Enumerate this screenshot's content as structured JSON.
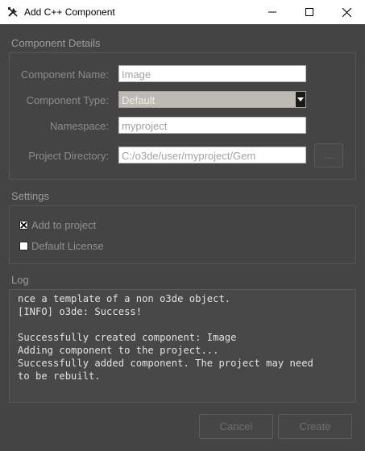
{
  "window": {
    "title": "Add C++ Component",
    "controls": [
      "minimize",
      "maximize",
      "close"
    ]
  },
  "component_details": {
    "heading": "Component Details",
    "name_label": "Component Name:",
    "name_value": "Image",
    "type_label": "Component Type:",
    "type_value": "Default",
    "namespace_label": "Namespace:",
    "namespace_value": "myproject",
    "directory_label": "Project Directory:",
    "directory_value": "C:/o3de/user/myproject/Gem",
    "browse_label": "..."
  },
  "settings": {
    "heading": "Settings",
    "add_to_project_label": "Add to project",
    "add_to_project_checked": true,
    "default_license_label": "Default License",
    "default_license_checked": false
  },
  "log": {
    "heading": "Log",
    "lines": [
      "nce a template of a non o3de object.",
      "[INFO] o3de: Success!",
      "",
      "Successfully created component: Image",
      "Adding component to the project...",
      "Successfully added component. The project may need",
      "to be rebuilt."
    ]
  },
  "footer": {
    "cancel_label": "Cancel",
    "create_label": "Create"
  },
  "icons": {
    "app": "tools-icon",
    "checkbox_checked": "checkmark-icon"
  }
}
